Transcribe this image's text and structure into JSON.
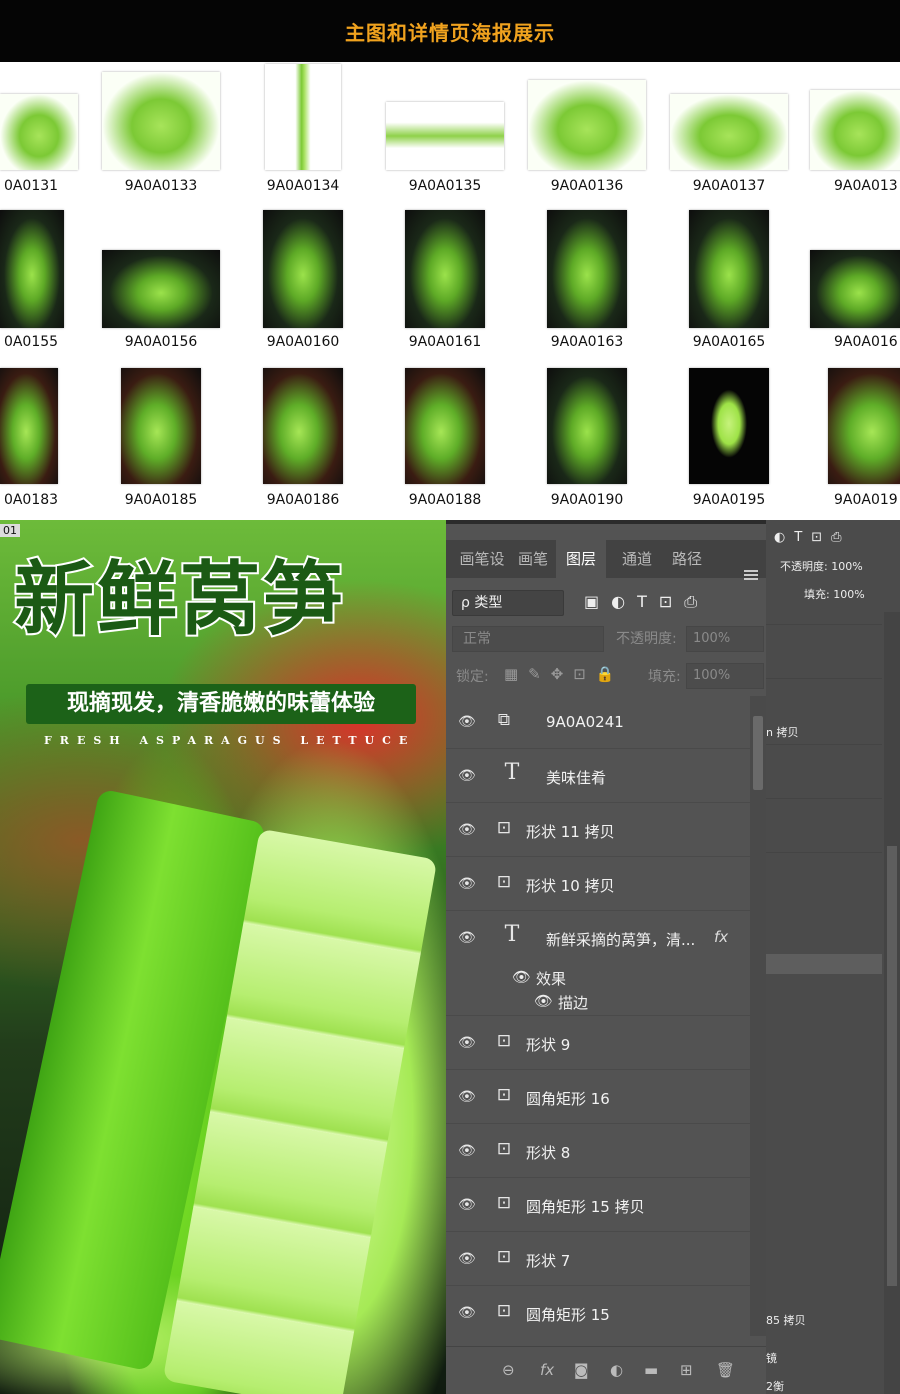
{
  "header": {
    "title": "主图和详情页海报展示"
  },
  "thumbnails": {
    "row1": [
      "0A0131",
      "9A0A0133",
      "9A0A0134",
      "9A0A0135",
      "9A0A0136",
      "9A0A0137",
      "9A0A013"
    ],
    "row2": [
      "0A0155",
      "9A0A0156",
      "9A0A0160",
      "9A0A0161",
      "9A0A0163",
      "9A0A0165",
      "9A0A016"
    ],
    "row3": [
      "0A0183",
      "9A0A0185",
      "9A0A0186",
      "9A0A0188",
      "9A0A0190",
      "9A0A0195",
      "9A0A019"
    ]
  },
  "poster": {
    "tag": "01",
    "title": "新鲜莴笋",
    "slogan": "现摘现发，清香脆嫩的味蕾体验",
    "english": "FRESH ASPARAGUS LETTUCE"
  },
  "panel": {
    "tabs": [
      "画笔设",
      "画笔",
      "图层",
      "通道",
      "路径"
    ],
    "active_tab": "图层",
    "filter_label": "ρ 类型",
    "filter_icons": "▣◐T⊡⎙",
    "blend_mode": "正常",
    "opacity_label": "不透明度:",
    "opacity_value": "100%",
    "lock_label": "锁定:",
    "lock_icons": "▦✎✥⊡🔒",
    "fill_label": "填充:",
    "fill_value": "100%",
    "layers": [
      {
        "kind": "⧉",
        "name": "9A0A0241"
      },
      {
        "kind": "T",
        "name": "美味佳肴"
      },
      {
        "kind": "⊡",
        "name": "形状 11 拷贝"
      },
      {
        "kind": "⊡",
        "name": "形状 10 拷贝"
      },
      {
        "kind": "T",
        "name": "新鲜采摘的莴笋，清...",
        "fx": "fx",
        "effects_label": "效果",
        "stroke_label": "描边"
      },
      {
        "kind": "⊡",
        "name": "形状 9"
      },
      {
        "kind": "⊡",
        "name": "圆角矩形 16"
      },
      {
        "kind": "⊡",
        "name": "形状 8"
      },
      {
        "kind": "⊡",
        "name": "圆角矩形 15 拷贝"
      },
      {
        "kind": "⊡",
        "name": "形状 7"
      },
      {
        "kind": "⊡",
        "name": "圆角矩形 15"
      }
    ],
    "bottom_icons": [
      "⊖",
      "fx",
      "◙",
      "◐",
      "▬",
      "⊞",
      "🗑"
    ]
  },
  "side_panel": {
    "tools": "◐T⊡⎙",
    "opacity": "不透明度: 100%",
    "fill": "填充: 100%",
    "copy1": "n 拷贝",
    "copy2": "85 拷贝",
    "mirror": "镜",
    "balance": "2衡"
  }
}
